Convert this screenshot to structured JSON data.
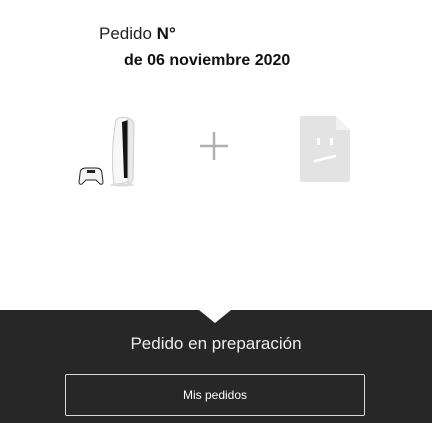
{
  "order": {
    "label": "Pedido",
    "number_label": "N°",
    "date": "de 06 noviembre 2020"
  },
  "products": {
    "items": [
      {
        "icon": "ps5-console-icon"
      },
      {
        "icon": "plus-icon"
      },
      {
        "icon": "missing-image-icon"
      }
    ]
  },
  "status": {
    "text": "Pedido en preparación",
    "button_label": "Mis pedidos"
  },
  "colors": {
    "status_bar_bg": "#272727",
    "text_dark": "#111111",
    "icon_grey": "#e3e3e3"
  }
}
